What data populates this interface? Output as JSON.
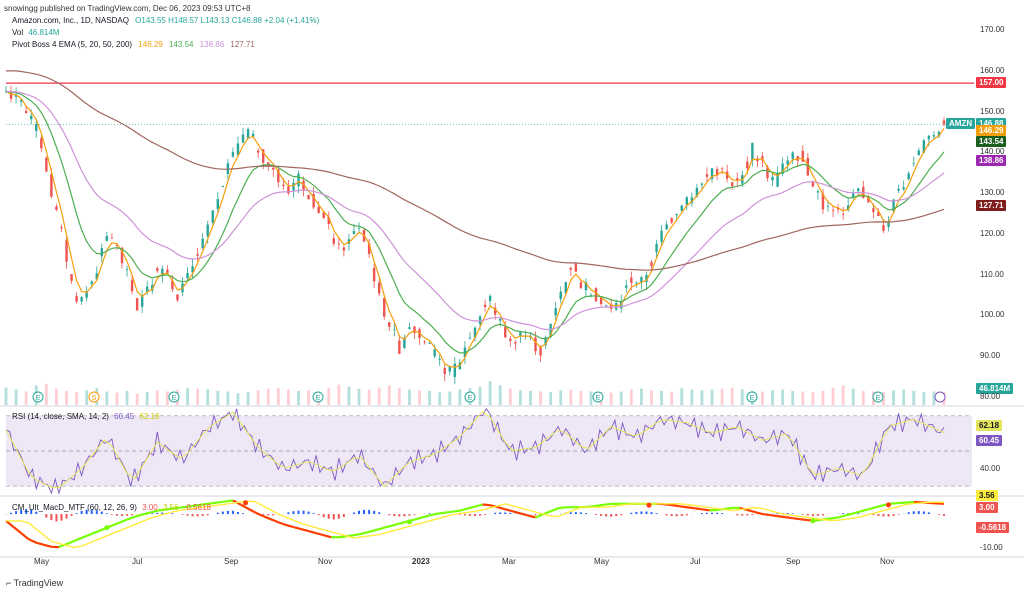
{
  "header": {
    "published": "snowingg published on TradingView.com, Dec 06, 2023 09:53 UTC+8",
    "symbol": "Amazon.com, Inc., 1D, NASDAQ",
    "ohlc": "O143.55 H148.57 L143.13 C146.88 +2.04 (+1.41%)",
    "vol_label": "Vol",
    "vol_value": "46.814M",
    "ema_label": "Pivot Boss 4 EMA (5, 20, 50, 200)",
    "ema_values": [
      "146.29",
      "143.54",
      "138.86",
      "127.71"
    ],
    "rsi_label": "RSI (14, close, SMA, 14, 2)",
    "rsi_values": [
      "60.45",
      "62.18"
    ],
    "macd_label": "CM_Ult_MacD_MTF (60, 12, 26, 9)",
    "macd_values": [
      "3.00",
      "3.56",
      "-0.5618"
    ]
  },
  "footer_logo": "TradingView",
  "colors": {
    "up": "#26a69a",
    "down": "#ef5350",
    "ema5": "#f59e0b",
    "ema20": "#4caf50",
    "ema50": "#ce93d8",
    "ema200": "#a1665e",
    "resistance": "#f23645",
    "rsi": "#7e57c2",
    "rsi_ma": "#e6e65c",
    "rsi_band": "#ede7f6"
  },
  "chart_data": [
    {
      "type": "candlestick",
      "ticker_label": "AMZN",
      "x_ticks": [
        "May",
        "Jul",
        "Sep",
        "Nov",
        "2023",
        "Mar",
        "May",
        "Jul",
        "Sep",
        "Nov"
      ],
      "y_ticks": [
        "170.00",
        "160.00",
        "150.00",
        "140.00",
        "130.00",
        "120.00",
        "110.00",
        "100.00",
        "90.00",
        "80.00"
      ],
      "ylim": [
        78,
        172
      ],
      "horizontal_line": {
        "value": 157.0,
        "label": "157.00"
      },
      "last_price": {
        "value": 146.88,
        "label": "146.88"
      },
      "ema_labels": [
        {
          "name": "EMA 5",
          "value": 146.29,
          "label": "146.29"
        },
        {
          "name": "EMA 20",
          "value": 143.54,
          "label": "143.54"
        },
        {
          "name": "EMA 50",
          "value": 138.86,
          "label": "138.86"
        },
        {
          "name": "EMA 200",
          "value": 127.71,
          "label": "127.71"
        }
      ],
      "close_path": [
        [
          0,
          155
        ],
        [
          6,
          152
        ],
        [
          10,
          149
        ],
        [
          14,
          142
        ],
        [
          18,
          130
        ],
        [
          22,
          120
        ],
        [
          26,
          108
        ],
        [
          29,
          103
        ],
        [
          33,
          107
        ],
        [
          37,
          113
        ],
        [
          41,
          121
        ],
        [
          45,
          115
        ],
        [
          49,
          108
        ],
        [
          52,
          102
        ],
        [
          56,
          106
        ],
        [
          60,
          112
        ],
        [
          64,
          111
        ],
        [
          68,
          105
        ],
        [
          72,
          109
        ],
        [
          76,
          116
        ],
        [
          80,
          121
        ],
        [
          84,
          128
        ],
        [
          88,
          136
        ],
        [
          92,
          142
        ],
        [
          96,
          145
        ],
        [
          100,
          141
        ],
        [
          104,
          137
        ],
        [
          108,
          133
        ],
        [
          112,
          131
        ],
        [
          116,
          134
        ],
        [
          120,
          130
        ],
        [
          124,
          126
        ],
        [
          128,
          121
        ],
        [
          132,
          116
        ],
        [
          136,
          118
        ],
        [
          140,
          122
        ],
        [
          144,
          115
        ],
        [
          148,
          104
        ],
        [
          152,
          98
        ],
        [
          156,
          92
        ],
        [
          160,
          98
        ],
        [
          164,
          96
        ],
        [
          168,
          92
        ],
        [
          172,
          88
        ],
        [
          176,
          86
        ],
        [
          180,
          89
        ],
        [
          184,
          95
        ],
        [
          188,
          100
        ],
        [
          192,
          104
        ],
        [
          196,
          98
        ],
        [
          200,
          93
        ],
        [
          204,
          96
        ],
        [
          208,
          94
        ],
        [
          212,
          91
        ],
        [
          216,
          97
        ],
        [
          220,
          106
        ],
        [
          224,
          112
        ],
        [
          228,
          108
        ],
        [
          232,
          106
        ],
        [
          236,
          104
        ],
        [
          240,
          101
        ],
        [
          244,
          104
        ],
        [
          248,
          109
        ],
        [
          252,
          108
        ],
        [
          256,
          113
        ],
        [
          260,
          120
        ],
        [
          264,
          124
        ],
        [
          268,
          128
        ],
        [
          272,
          130
        ],
        [
          276,
          132
        ],
        [
          280,
          136
        ],
        [
          284,
          135
        ],
        [
          288,
          131
        ],
        [
          292,
          134
        ],
        [
          296,
          141
        ],
        [
          300,
          137
        ],
        [
          304,
          133
        ],
        [
          308,
          136
        ],
        [
          312,
          141
        ],
        [
          316,
          138
        ],
        [
          320,
          133
        ],
        [
          324,
          127
        ],
        [
          328,
          125
        ],
        [
          332,
          124
        ],
        [
          336,
          131
        ],
        [
          340,
          130
        ],
        [
          344,
          126
        ],
        [
          348,
          121
        ],
        [
          352,
          127
        ],
        [
          356,
          133
        ],
        [
          360,
          138
        ],
        [
          364,
          143
        ],
        [
          368,
          145
        ],
        [
          372,
          146.88
        ]
      ],
      "volume_approx": [
        62,
        55,
        48,
        70,
        75,
        58,
        50,
        45,
        52,
        60,
        48,
        44,
        50,
        40,
        46,
        52,
        48,
        55,
        60,
        58,
        56,
        50,
        48,
        42,
        46,
        52,
        58,
        60,
        55,
        50,
        52,
        48,
        60,
        72,
        65,
        58,
        55,
        62,
        70,
        60,
        55,
        52,
        50,
        45,
        48,
        56,
        60,
        65,
        85,
        70,
        58,
        52,
        50,
        48,
        46,
        52,
        55,
        50,
        48,
        46,
        44,
        48,
        55,
        58,
        52,
        50,
        48,
        60,
        55,
        52,
        54,
        58,
        62,
        56,
        50,
        48,
        52,
        55,
        50,
        48,
        46,
        50,
        62,
        70,
        58,
        50,
        48,
        46,
        52,
        55,
        50,
        46,
        48,
        46.8
      ],
      "volume_last_label": "46.814M"
    },
    {
      "type": "line",
      "name": "RSI",
      "y_ticks": [
        "40.00"
      ],
      "ylim": [
        25,
        75
      ],
      "band": [
        30,
        70
      ],
      "last_label": "60.45",
      "ma_label": "62.18",
      "rsi_path": [
        [
          0,
          62
        ],
        [
          10,
          35
        ],
        [
          20,
          28
        ],
        [
          30,
          40
        ],
        [
          40,
          58
        ],
        [
          50,
          32
        ],
        [
          60,
          55
        ],
        [
          70,
          45
        ],
        [
          80,
          63
        ],
        [
          90,
          72
        ],
        [
          100,
          52
        ],
        [
          110,
          40
        ],
        [
          120,
          44
        ],
        [
          130,
          38
        ],
        [
          140,
          48
        ],
        [
          150,
          30
        ],
        [
          160,
          44
        ],
        [
          170,
          48
        ],
        [
          180,
          58
        ],
        [
          190,
          74
        ],
        [
          200,
          50
        ],
        [
          210,
          52
        ],
        [
          220,
          63
        ],
        [
          230,
          50
        ],
        [
          240,
          64
        ],
        [
          250,
          58
        ],
        [
          260,
          68
        ],
        [
          270,
          66
        ],
        [
          280,
          60
        ],
        [
          290,
          64
        ],
        [
          300,
          56
        ],
        [
          310,
          60
        ],
        [
          320,
          36
        ],
        [
          330,
          40
        ],
        [
          340,
          36
        ],
        [
          350,
          64
        ],
        [
          360,
          68
        ],
        [
          372,
          60.45
        ]
      ]
    },
    {
      "type": "histogram",
      "name": "MACD",
      "y_ticks": [
        "-10.00"
      ],
      "ylim": [
        -12,
        5
      ],
      "labels": [
        "3.56",
        "3.00",
        "-0.5618"
      ],
      "macd_path": [
        [
          0,
          -2
        ],
        [
          10,
          -8
        ],
        [
          20,
          -10
        ],
        [
          30,
          -7
        ],
        [
          40,
          -4
        ],
        [
          50,
          -1
        ],
        [
          60,
          1
        ],
        [
          70,
          2
        ],
        [
          80,
          3
        ],
        [
          90,
          4
        ],
        [
          100,
          0
        ],
        [
          110,
          -3
        ],
        [
          120,
          -5
        ],
        [
          130,
          -7
        ],
        [
          140,
          -6
        ],
        [
          150,
          -4
        ],
        [
          160,
          -2
        ],
        [
          170,
          0
        ],
        [
          180,
          1
        ],
        [
          190,
          3
        ],
        [
          200,
          1
        ],
        [
          210,
          -1
        ],
        [
          220,
          2
        ],
        [
          230,
          2
        ],
        [
          240,
          3
        ],
        [
          250,
          3
        ],
        [
          260,
          3
        ],
        [
          270,
          2
        ],
        [
          280,
          1
        ],
        [
          290,
          2
        ],
        [
          300,
          0
        ],
        [
          310,
          -1
        ],
        [
          320,
          -2
        ],
        [
          330,
          -1
        ],
        [
          340,
          1
        ],
        [
          350,
          3
        ],
        [
          360,
          3.56
        ],
        [
          372,
          3.0
        ]
      ]
    }
  ]
}
